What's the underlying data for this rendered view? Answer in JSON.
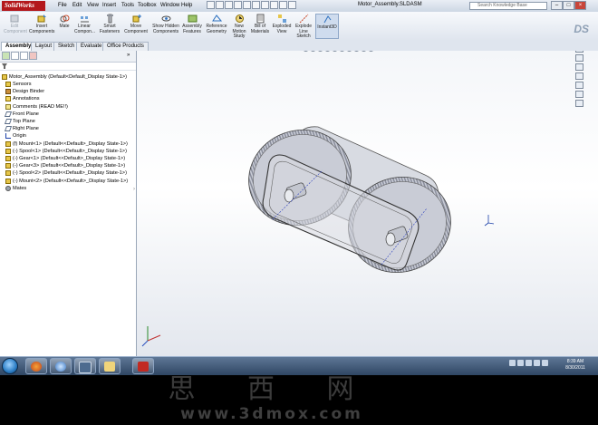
{
  "app": {
    "logo_text": "SolidWorks",
    "menus": [
      "File",
      "Edit",
      "View",
      "Insert",
      "Tools",
      "Toolbox",
      "Window",
      "Help"
    ],
    "document_title": "Motor_Assembly.SLDASM",
    "search_placeholder": "Search Knowledge Base",
    "window_buttons": [
      "–",
      "□",
      "×"
    ]
  },
  "ribbon": {
    "commands": [
      {
        "label": "Edit Component",
        "icon": "edit-component-icon",
        "enabled": false
      },
      {
        "label": "Insert Components",
        "icon": "insert-components-icon",
        "enabled": true
      },
      {
        "label": "Mate",
        "icon": "mate-icon",
        "enabled": true
      },
      {
        "label": "Linear Compon...",
        "icon": "linear-pattern-icon",
        "enabled": true
      },
      {
        "label": "Smart Fasteners",
        "icon": "smart-fasteners-icon",
        "enabled": true
      },
      {
        "label": "Move Component",
        "icon": "move-component-icon",
        "enabled": true
      },
      {
        "label": "Show Hidden Components",
        "icon": "show-hidden-icon",
        "enabled": true
      },
      {
        "label": "Assembly Features",
        "icon": "assembly-features-icon",
        "enabled": true
      },
      {
        "label": "Reference Geometry",
        "icon": "reference-geometry-icon",
        "enabled": true
      },
      {
        "label": "New Motion Study",
        "icon": "motion-study-icon",
        "enabled": true
      },
      {
        "label": "Bill of Materials",
        "icon": "bom-icon",
        "enabled": true
      },
      {
        "label": "Exploded View",
        "icon": "exploded-view-icon",
        "enabled": true
      },
      {
        "label": "Explode Line Sketch",
        "icon": "explode-line-icon",
        "enabled": true
      },
      {
        "label": "Instant3D",
        "icon": "instant3d-icon",
        "enabled": true
      }
    ]
  },
  "tabs": [
    "Assembly",
    "Layout",
    "Sketch",
    "Evaluate",
    "Office Products"
  ],
  "active_tab": "Assembly",
  "tree": {
    "root": "Motor_Assembly  (Default<Default_Display State-1>)",
    "items": [
      {
        "label": "Sensors",
        "icon": "sensors-icon"
      },
      {
        "label": "Design Binder",
        "icon": "design-binder-icon"
      },
      {
        "label": "Annotations",
        "icon": "annotations-icon"
      },
      {
        "label": "Comments (READ ME!!)",
        "icon": "comments-icon"
      },
      {
        "label": "Front Plane",
        "icon": "plane-icon"
      },
      {
        "label": "Top Plane",
        "icon": "plane-icon"
      },
      {
        "label": "Right Plane",
        "icon": "plane-icon"
      },
      {
        "label": "Origin",
        "icon": "origin-icon"
      },
      {
        "label": "(f) Mount<1> (Default<<Default>_Display State-1>)",
        "icon": "part-icon"
      },
      {
        "label": "(-) Spool<1> (Default<<Default>_Display State-1>)",
        "icon": "part-icon"
      },
      {
        "label": "(-) Gear<1> (Default<<Default>_Display State-1>)",
        "icon": "part-icon"
      },
      {
        "label": "(-) Gear<3> (Default<<Default>_Display State-1>)",
        "icon": "part-icon"
      },
      {
        "label": "(-) Spool<2> (Default<<Default>_Display State-1>)",
        "icon": "part-icon"
      },
      {
        "label": "(-) Mount<2> (Default<<Default>_Display State-1>)",
        "icon": "part-icon"
      },
      {
        "label": "Mates",
        "icon": "mates-icon"
      }
    ]
  },
  "taskbar": {
    "clock_time": "8:39 AM",
    "clock_date": "8/30/2011"
  },
  "watermark": {
    "chars": "思 西 网",
    "url": "www.3dmox.com"
  },
  "colors": {
    "accent": "#b3171c",
    "gear_body": "#c9ccd6",
    "plate": "#d8dbe2"
  }
}
